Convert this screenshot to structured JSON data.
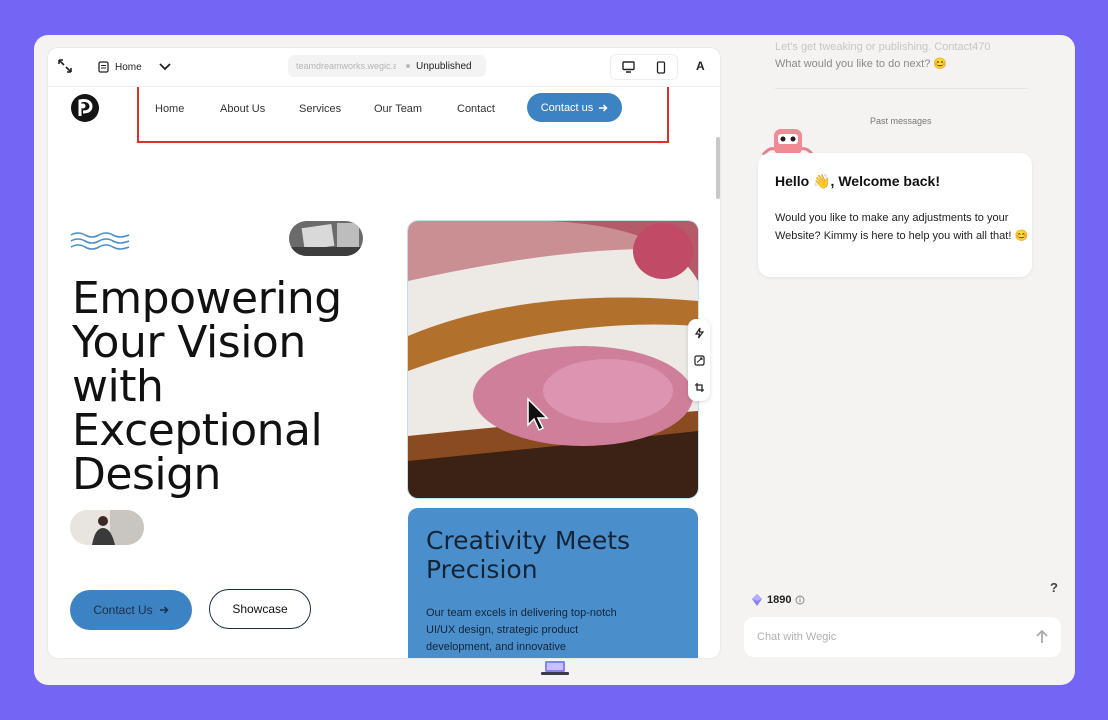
{
  "toolbar": {
    "page_label": "Home",
    "url_text": "teamdreamworks.wegic.app",
    "status": "Unpublished",
    "font_glyph": "A"
  },
  "site": {
    "nav": [
      "Home",
      "About Us",
      "Services",
      "Our Team",
      "Contact"
    ],
    "nav_cta": "Contact us",
    "headline_lines": [
      "Empowering",
      "Your Vision",
      "with",
      "Exceptional",
      "Design"
    ],
    "btn_contact": "Contact Us",
    "btn_showcase": "Showcase",
    "card_title": "Creativity Meets Precision",
    "card_text": "Our team excels in delivering top-notch UI/UX design, strategic product development, and innovative"
  },
  "chat": {
    "prev_line1": "Let's get tweaking or publishing. Contact470",
    "prev_line2": "What would you like to do next? 😊",
    "past_messages": "Past messages",
    "greeting": "Hello 👋, Welcome back!",
    "message": "Would you like to make any adjustments to your Website? Kimmy is here to help you with all that! 😊",
    "help": "?",
    "credits": "1890",
    "input_placeholder": "Chat with Wegic"
  },
  "colors": {
    "background": "#7466f4",
    "accent_blue": "#3d82c3",
    "highlight_red": "#e0302a",
    "card_blue": "#4a8fcb"
  },
  "icons": [
    "expand-icon",
    "page-icon",
    "chevron-down-icon",
    "desktop-icon",
    "mobile-icon",
    "font-icon",
    "lightning-icon",
    "replace-image-icon",
    "crop-icon",
    "arrow-right-icon",
    "gem-icon",
    "info-icon",
    "send-arrow-icon",
    "mascot-icon",
    "laptop-icon",
    "cursor-icon"
  ]
}
